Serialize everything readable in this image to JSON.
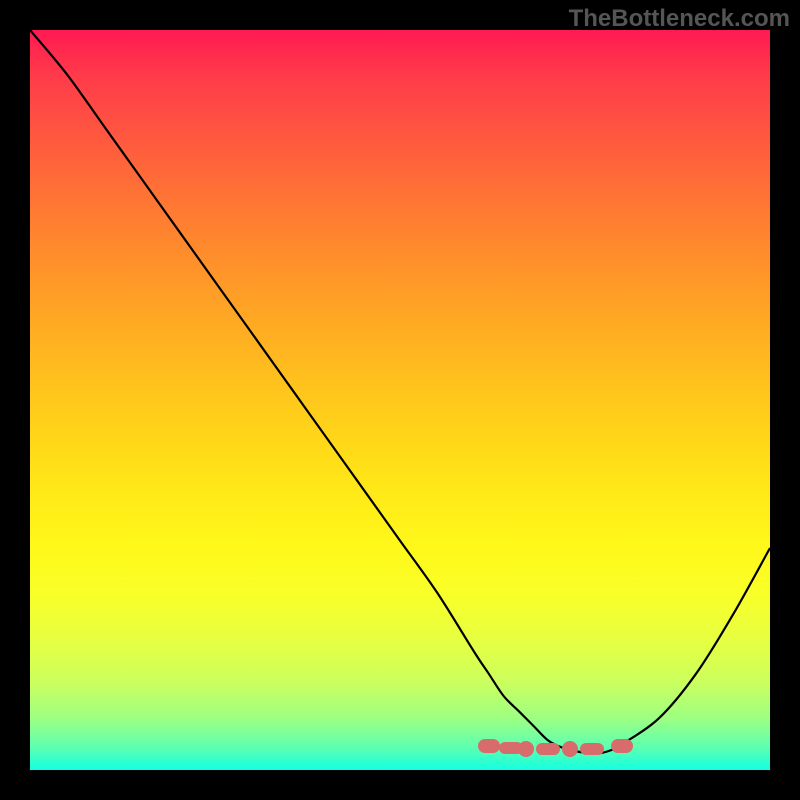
{
  "watermark": "TheBottleneck.com",
  "chart_data": {
    "type": "line",
    "title": "",
    "xlabel": "",
    "ylabel": "",
    "xlim": [
      0,
      100
    ],
    "ylim": [
      0,
      100
    ],
    "x": [
      0,
      5,
      10,
      15,
      20,
      25,
      30,
      35,
      40,
      45,
      50,
      55,
      60,
      62,
      64,
      66,
      68,
      70,
      72,
      74,
      76,
      78,
      80,
      85,
      90,
      95,
      100
    ],
    "values": [
      100,
      94,
      87,
      80,
      73,
      66,
      59,
      52,
      45,
      38,
      31,
      24,
      16,
      13,
      10,
      8,
      6,
      4,
      3,
      2.5,
      2.2,
      2.5,
      3.5,
      7,
      13,
      21,
      30
    ],
    "markers": {
      "x": [
        62,
        65,
        67,
        70,
        73,
        76,
        80
      ],
      "y": [
        3.2,
        3.0,
        2.9,
        2.8,
        2.8,
        2.9,
        3.3
      ]
    },
    "gradient_colors": {
      "top": "#ff1a52",
      "bottom": "#12ffe2"
    },
    "curve_color": "#000000",
    "marker_color": "#d86b6b"
  }
}
